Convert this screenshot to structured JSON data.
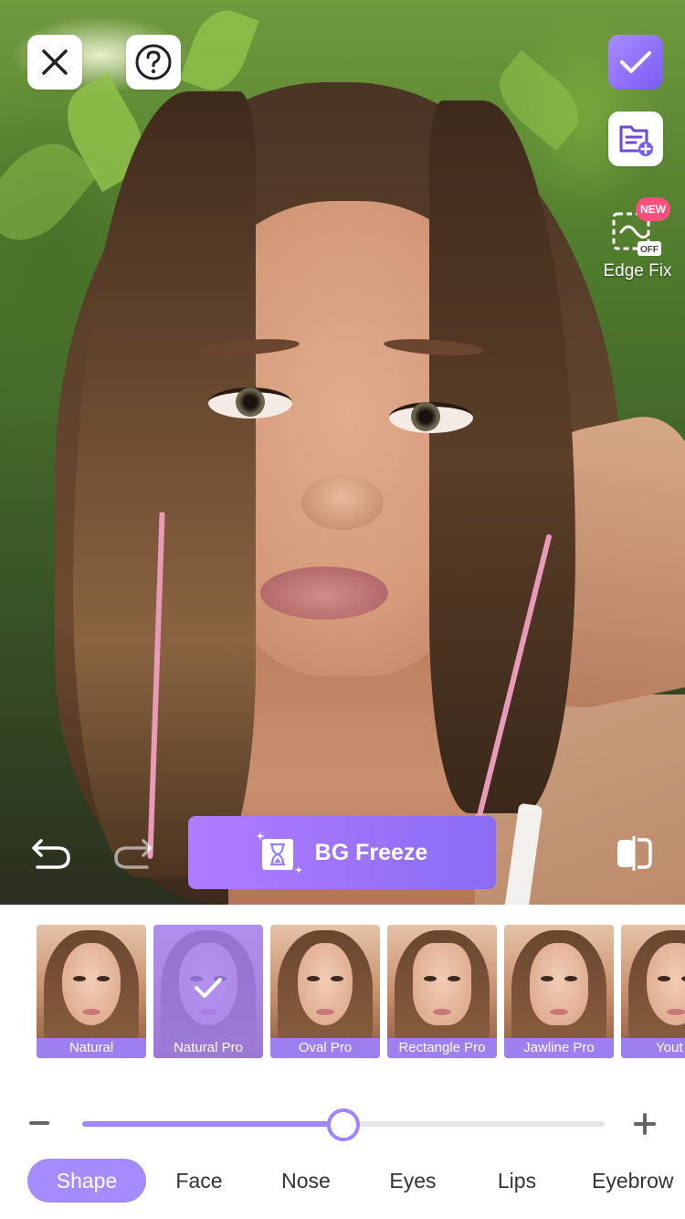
{
  "toolbar": {
    "close_icon": "close-icon",
    "help_icon": "help-icon",
    "confirm_icon": "checkmark-icon",
    "save_icon": "folder-add-icon",
    "edge_fix": {
      "label": "Edge Fix",
      "badge": "NEW",
      "state_text": "OFF"
    }
  },
  "bg_freeze": {
    "label": "BG Freeze",
    "icon": "hourglass-icon"
  },
  "history": {
    "undo_icon": "undo-icon",
    "redo_icon": "redo-icon",
    "compare_icon": "compare-icon"
  },
  "presets": [
    {
      "label": "Natural",
      "selected": false
    },
    {
      "label": "Natural Pro",
      "selected": true
    },
    {
      "label": "Oval Pro",
      "selected": false
    },
    {
      "label": "Rectangle Pro",
      "selected": false
    },
    {
      "label": "Jawline Pro",
      "selected": false
    },
    {
      "label": "Yout",
      "selected": false
    }
  ],
  "slider": {
    "value_fraction": 0.5
  },
  "tabs": [
    {
      "label": "Shape",
      "active": true
    },
    {
      "label": "Face",
      "active": false
    },
    {
      "label": "Nose",
      "active": false
    },
    {
      "label": "Eyes",
      "active": false
    },
    {
      "label": "Lips",
      "active": false
    },
    {
      "label": "Eyebrow",
      "active": false
    }
  ],
  "colors": {
    "accent": "#9e86ff",
    "confirm": "#7a5cf2",
    "badge": "#ff4f7e"
  }
}
